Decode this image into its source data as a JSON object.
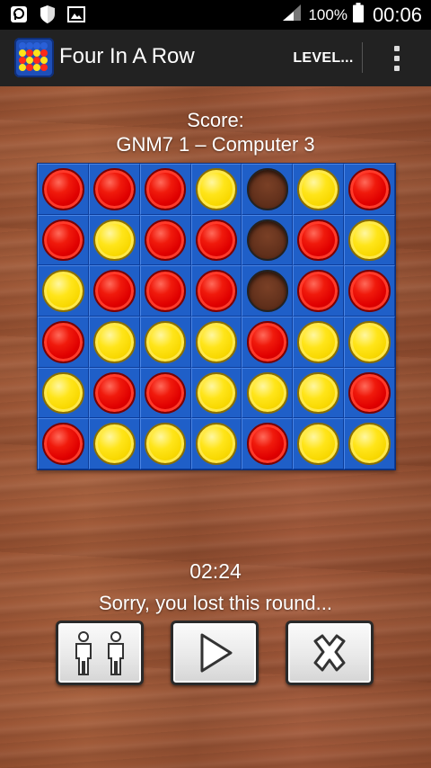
{
  "status_bar": {
    "battery_percent": "100%",
    "time": "00:06",
    "icons": [
      "notification-icon",
      "shield-icon",
      "image-icon",
      "signal-icon",
      "battery-icon"
    ]
  },
  "action_bar": {
    "title": "Four In A Row",
    "level_label": "LEVEL...",
    "app_icon": "four-in-a-row-app-icon",
    "overflow_icon": "overflow-menu-icon"
  },
  "score": {
    "label": "Score:",
    "line": "GNM7 1 – Computer 3"
  },
  "board": {
    "rows": 6,
    "cols": 7,
    "cells": [
      [
        "red",
        "red",
        "red",
        "yellow",
        "empty",
        "yellow",
        "red"
      ],
      [
        "red",
        "yellow",
        "red",
        "red",
        "empty",
        "red",
        "yellow"
      ],
      [
        "yellow",
        "red",
        "red",
        "red",
        "empty",
        "red",
        "red"
      ],
      [
        "red",
        "yellow",
        "yellow",
        "yellow",
        "red",
        "yellow",
        "yellow"
      ],
      [
        "yellow",
        "red",
        "red",
        "yellow",
        "yellow",
        "yellow",
        "red"
      ],
      [
        "red",
        "yellow",
        "yellow",
        "yellow",
        "red",
        "yellow",
        "yellow"
      ]
    ]
  },
  "timer": "02:24",
  "message": "Sorry, you lost this round...",
  "buttons": {
    "players_icon": "two-players-icon",
    "play_icon": "play-icon",
    "close_icon": "close-icon"
  },
  "colors": {
    "board_blue": "#1f5fc8",
    "red_disc": "#e00000",
    "yellow_disc": "#f8d800",
    "wood": "#9a5434",
    "action_bar": "#222222"
  }
}
